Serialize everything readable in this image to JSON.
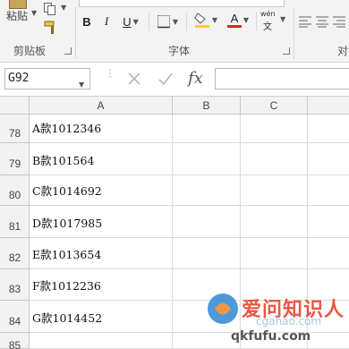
{
  "ribbon": {
    "clipboard": {
      "paste_label": "粘贴",
      "group_label": "剪贴板"
    },
    "font": {
      "group_label": "字体",
      "bold_label": "B",
      "italic_label": "I",
      "underline_label": "U",
      "font_color_glyph": "A",
      "phonetic_top": "wén",
      "phonetic_bottom": "文"
    },
    "alignment": {
      "group_label_partial": "对"
    }
  },
  "formula_bar": {
    "name_box_value": "G92",
    "fx_label": "fx"
  },
  "grid": {
    "columns": [
      "A",
      "B",
      "C"
    ],
    "rows": [
      {
        "number": "78",
        "a": "A款1012346"
      },
      {
        "number": "79",
        "a": "B款101564"
      },
      {
        "number": "80",
        "a": "C款1014692"
      },
      {
        "number": "81",
        "a": "D款1017985"
      },
      {
        "number": "82",
        "a": "E款1013654"
      },
      {
        "number": "83",
        "a": "F款1012236"
      },
      {
        "number": "84",
        "a": "G款1014452"
      },
      {
        "number": "85",
        "a": ""
      }
    ]
  },
  "colors": {
    "fill_color": "#ffd800",
    "font_color": "#e2231a",
    "ribbon_bg": "#f3f3f3"
  },
  "watermark": {
    "icon": "watermark-logo",
    "text": "爱问知识人",
    "url": "qkfufu.com",
    "url_ghost": "cgahao.com"
  }
}
